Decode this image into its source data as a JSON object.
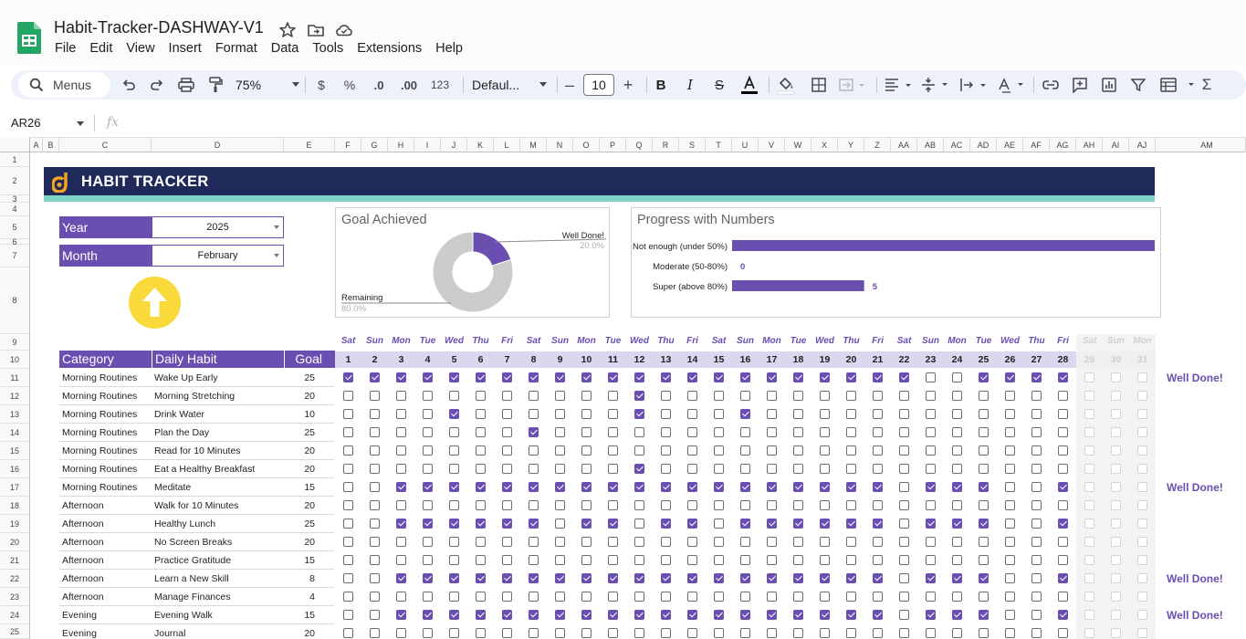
{
  "app": {
    "doc_title": "Habit-Tracker-DASHWAY-V1",
    "menu": [
      "File",
      "Edit",
      "View",
      "Insert",
      "Format",
      "Data",
      "Tools",
      "Extensions",
      "Help"
    ]
  },
  "toolbar": {
    "search_label": "Menus",
    "zoom": "75%",
    "currency": "$",
    "percent": "%",
    "decrease_decimals": ".0",
    "increase_decimals": ".00",
    "number_format": "123",
    "font": "Defaul...",
    "font_size": "10",
    "minus": "–",
    "plus": "+"
  },
  "formula_bar": {
    "name_box": "AR26",
    "fx": "fx"
  },
  "columns": [
    "A",
    "B",
    "C",
    "D",
    "E",
    "F",
    "G",
    "H",
    "I",
    "J",
    "K",
    "L",
    "M",
    "N",
    "O",
    "P",
    "Q",
    "R",
    "S",
    "T",
    "U",
    "V",
    "W",
    "X",
    "Y",
    "Z",
    "AA",
    "AB",
    "AC",
    "AD",
    "AE",
    "AF",
    "AG",
    "AH",
    "AI",
    "AJ",
    "AM"
  ],
  "rows": [
    "1",
    "2",
    "3",
    "4",
    "5",
    "6",
    "7",
    "8",
    "9",
    "10",
    "11",
    "12",
    "13",
    "14",
    "15",
    "16",
    "17",
    "18",
    "19",
    "20",
    "21",
    "22",
    "23",
    "24",
    "25"
  ],
  "sheet": {
    "title": "HABIT TRACKER",
    "year_label": "Year",
    "year_value": "2025",
    "month_label": "Month",
    "month_value": "February"
  },
  "goal_chart": {
    "title": "Goal Achieved",
    "slices": [
      {
        "label": "Well Done!",
        "value": "20.0%",
        "fraction": 0.2,
        "color": "#6a4fb0"
      },
      {
        "label": "Remaining",
        "value": "80.0%",
        "fraction": 0.8,
        "color": "#cccccc"
      }
    ]
  },
  "progress_chart": {
    "title": "Progress with Numbers",
    "bars": [
      {
        "label": "Not enough (under 50%)",
        "value": 16,
        "value_label": ""
      },
      {
        "label": "Moderate (50-80%)",
        "value": 0,
        "value_label": "0"
      },
      {
        "label": "Super (above 80%)",
        "value": 5,
        "value_label": "5"
      }
    ],
    "max": 16,
    "color": "#6a4fb0"
  },
  "table": {
    "headers": {
      "category": "Category",
      "habit": "Daily Habit",
      "goal": "Goal"
    },
    "days": [
      {
        "n": "1",
        "d": "Sat"
      },
      {
        "n": "2",
        "d": "Sun"
      },
      {
        "n": "3",
        "d": "Mon"
      },
      {
        "n": "4",
        "d": "Tue"
      },
      {
        "n": "5",
        "d": "Wed"
      },
      {
        "n": "6",
        "d": "Thu"
      },
      {
        "n": "7",
        "d": "Fri"
      },
      {
        "n": "8",
        "d": "Sat"
      },
      {
        "n": "9",
        "d": "Sun"
      },
      {
        "n": "10",
        "d": "Mon"
      },
      {
        "n": "11",
        "d": "Tue"
      },
      {
        "n": "12",
        "d": "Wed"
      },
      {
        "n": "13",
        "d": "Thu"
      },
      {
        "n": "14",
        "d": "Fri"
      },
      {
        "n": "15",
        "d": "Sat"
      },
      {
        "n": "16",
        "d": "Sun"
      },
      {
        "n": "17",
        "d": "Mon"
      },
      {
        "n": "18",
        "d": "Tue"
      },
      {
        "n": "19",
        "d": "Wed"
      },
      {
        "n": "20",
        "d": "Thu"
      },
      {
        "n": "21",
        "d": "Fri"
      },
      {
        "n": "22",
        "d": "Sat"
      },
      {
        "n": "23",
        "d": "Sun"
      },
      {
        "n": "24",
        "d": "Mon"
      },
      {
        "n": "25",
        "d": "Tue"
      },
      {
        "n": "26",
        "d": "Wed"
      },
      {
        "n": "27",
        "d": "Thu"
      },
      {
        "n": "28",
        "d": "Fri"
      },
      {
        "n": "29",
        "d": "Sat",
        "off": true
      },
      {
        "n": "30",
        "d": "Sun",
        "off": true
      },
      {
        "n": "31",
        "d": "Mon",
        "off": true
      }
    ],
    "rows": [
      {
        "category": "Morning Routines",
        "habit": "Wake Up Early",
        "goal": "25",
        "checks": "1111111111111111111111001111000",
        "status": "Well Done!"
      },
      {
        "category": "Morning Routines",
        "habit": "Morning Stretching",
        "goal": "20",
        "checks": "0000000000010000000000000000000",
        "status": ""
      },
      {
        "category": "Morning Routines",
        "habit": "Drink Water",
        "goal": "10",
        "checks": "0000100000010001000000000000000",
        "status": ""
      },
      {
        "category": "Morning Routines",
        "habit": "Plan the Day",
        "goal": "25",
        "checks": "0000000100000000000000000000000",
        "status": ""
      },
      {
        "category": "Morning Routines",
        "habit": "Read for 10 Minutes",
        "goal": "20",
        "checks": "0000000000000000000000000000000",
        "status": ""
      },
      {
        "category": "Morning Routines",
        "habit": "Eat a Healthy Breakfast",
        "goal": "20",
        "checks": "0000000000010000000000000000000",
        "status": ""
      },
      {
        "category": "Morning Routines",
        "habit": "Meditate",
        "goal": "15",
        "checks": "0011111111111111111110111001000",
        "status": "Well Done!"
      },
      {
        "category": "Afternoon",
        "habit": "Walk for 10 Minutes",
        "goal": "20",
        "checks": "0000000000000000000000000000000",
        "status": ""
      },
      {
        "category": "Afternoon",
        "habit": "Healthy Lunch",
        "goal": "25",
        "checks": "0011111101101101111110111001000",
        "status": ""
      },
      {
        "category": "Afternoon",
        "habit": "No Screen Breaks",
        "goal": "20",
        "checks": "0000000000000000000000000000000",
        "status": ""
      },
      {
        "category": "Afternoon",
        "habit": "Practice Gratitude",
        "goal": "15",
        "checks": "0000000000000000000000000000000",
        "status": ""
      },
      {
        "category": "Afternoon",
        "habit": "Learn a New Skill",
        "goal": "8",
        "checks": "0011111111111111111110111001000",
        "status": "Well Done!"
      },
      {
        "category": "Afternoon",
        "habit": "Manage Finances",
        "goal": "4",
        "checks": "0000000000000000000000000000000",
        "status": ""
      },
      {
        "category": "Evening",
        "habit": "Evening Walk",
        "goal": "15",
        "checks": "0011111111111111111110111001000",
        "status": "Well Done!"
      },
      {
        "category": "Evening",
        "habit": "Journal",
        "goal": "20",
        "checks": "0000000000000000000000000000000",
        "status": ""
      }
    ]
  },
  "colors": {
    "brand": "#1f2a5a",
    "accent": "#6a4fb0",
    "teal": "#7fd3c6",
    "yellow": "#f9da3a"
  }
}
